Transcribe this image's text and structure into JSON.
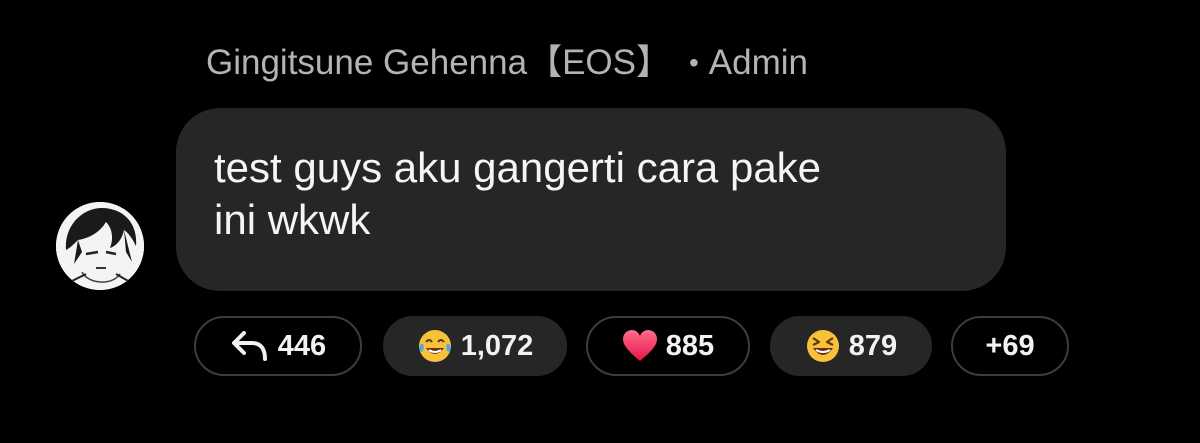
{
  "message": {
    "sender_name": "Gingitsune Gehenna【EOS】",
    "separator": "•",
    "role": "Admin",
    "text": "test guys aku gangerti cara pake\nini wkwk"
  },
  "reactions": {
    "replies": {
      "icon": "reply-arrow-icon",
      "count": "446"
    },
    "items": [
      {
        "icon": "face-with-tears-of-joy-emoji",
        "count": "1,072"
      },
      {
        "icon": "red-heart-emoji",
        "count": "885"
      },
      {
        "icon": "grinning-squinting-face-emoji",
        "count": "879"
      }
    ],
    "more": "+69"
  }
}
